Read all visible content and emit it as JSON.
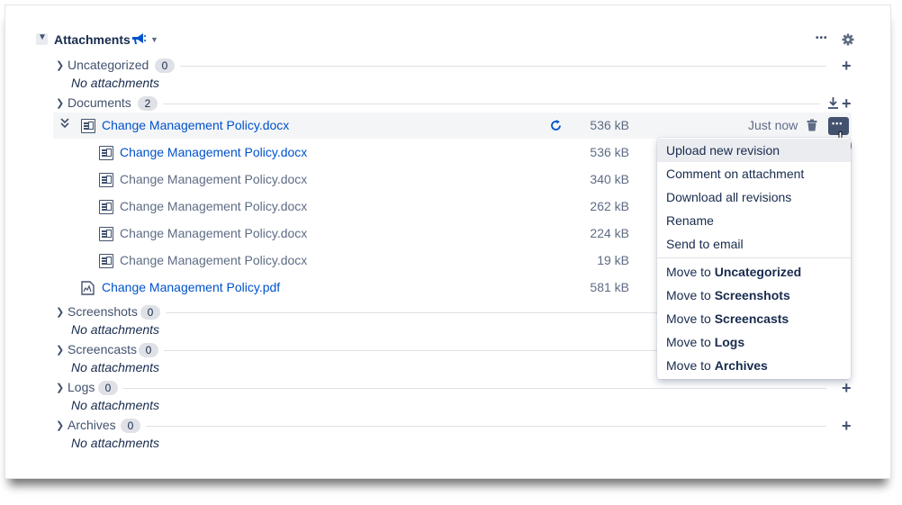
{
  "header": {
    "title": "Attachments",
    "more_label": "•••"
  },
  "sections": [
    {
      "name": "Uncategorized",
      "count": "0",
      "empty": "No attachments"
    },
    {
      "name": "Documents",
      "count": "2"
    },
    {
      "name": "Screenshots",
      "count": "0",
      "empty": "No attachments"
    },
    {
      "name": "Screencasts",
      "count": "0",
      "empty": "No attachments"
    },
    {
      "name": "Logs",
      "count": "0",
      "empty": "No attachments"
    },
    {
      "name": "Archives",
      "count": "0",
      "empty": "No attachments"
    }
  ],
  "files": {
    "main": {
      "name": "Change Management Policy.docx",
      "size": "536 kB",
      "time": "Just now",
      "more": "•••"
    },
    "revisions": [
      {
        "name": "Change Management Policy.docx",
        "size": "536 kB"
      },
      {
        "name": "Change Management Policy.docx",
        "size": "340 kB"
      },
      {
        "name": "Change Management Policy.docx",
        "size": "262 kB"
      },
      {
        "name": "Change Management Policy.docx",
        "size": "224 kB"
      },
      {
        "name": "Change Management Policy.docx",
        "size": "19 kB"
      }
    ],
    "pdf": {
      "name": "Change Management Policy.pdf",
      "size": "581 kB"
    }
  },
  "menu": {
    "items": [
      "Upload new revision",
      "Comment on attachment",
      "Download all revisions",
      "Rename",
      "Send to email"
    ],
    "move_prefix": "Move to ",
    "move_targets": [
      "Uncategorized",
      "Screenshots",
      "Screencasts",
      "Logs",
      "Archives"
    ]
  },
  "icons": {
    "chevron": "chevron-down-icon",
    "megaphone": "megaphone-icon",
    "gear": "gear-icon",
    "plus": "plus-icon",
    "download": "download-icon",
    "refresh": "refresh-icon",
    "trash": "trash-icon",
    "file": "file-icon",
    "pdf": "pdf-icon",
    "collapse": "double-chevron-icon",
    "cursor": "hand-cursor-icon"
  },
  "colors": {
    "link": "#0052cc",
    "accent_button": "#42526e",
    "highlight_row": "#f4f5f7"
  }
}
